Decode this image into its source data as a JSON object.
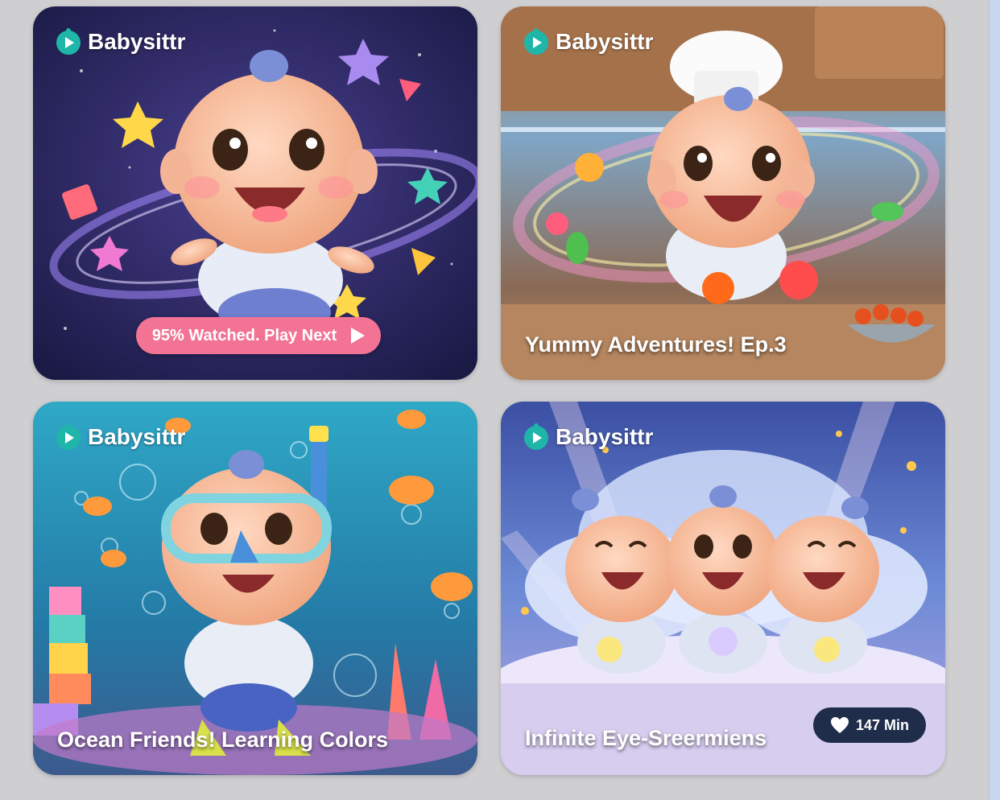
{
  "brand_name": "Babysittr",
  "colors": {
    "brand_teal": "#1fb5a8",
    "pink_button": "#f27394",
    "badge_navy": "#1f2d4a",
    "page_background": "#cfcfd1"
  },
  "cards": [
    {
      "brand": "Babysittr",
      "theme": "space",
      "action_label": "95% Watched. Play Next",
      "action_icon": "play-icon",
      "watched_percent": 95
    },
    {
      "brand": "Babysittr",
      "theme": "kitchen",
      "title": "Yummy Adventures! Ep.3"
    },
    {
      "brand": "Babysittr",
      "theme": "ocean",
      "title": "Ocean Friends! Learning Colors"
    },
    {
      "brand": "Babysittr",
      "theme": "clouds",
      "title": "Infinite Eye-Sreermiens",
      "badge": {
        "icon": "heart-icon",
        "label": "147 Min"
      }
    }
  ]
}
